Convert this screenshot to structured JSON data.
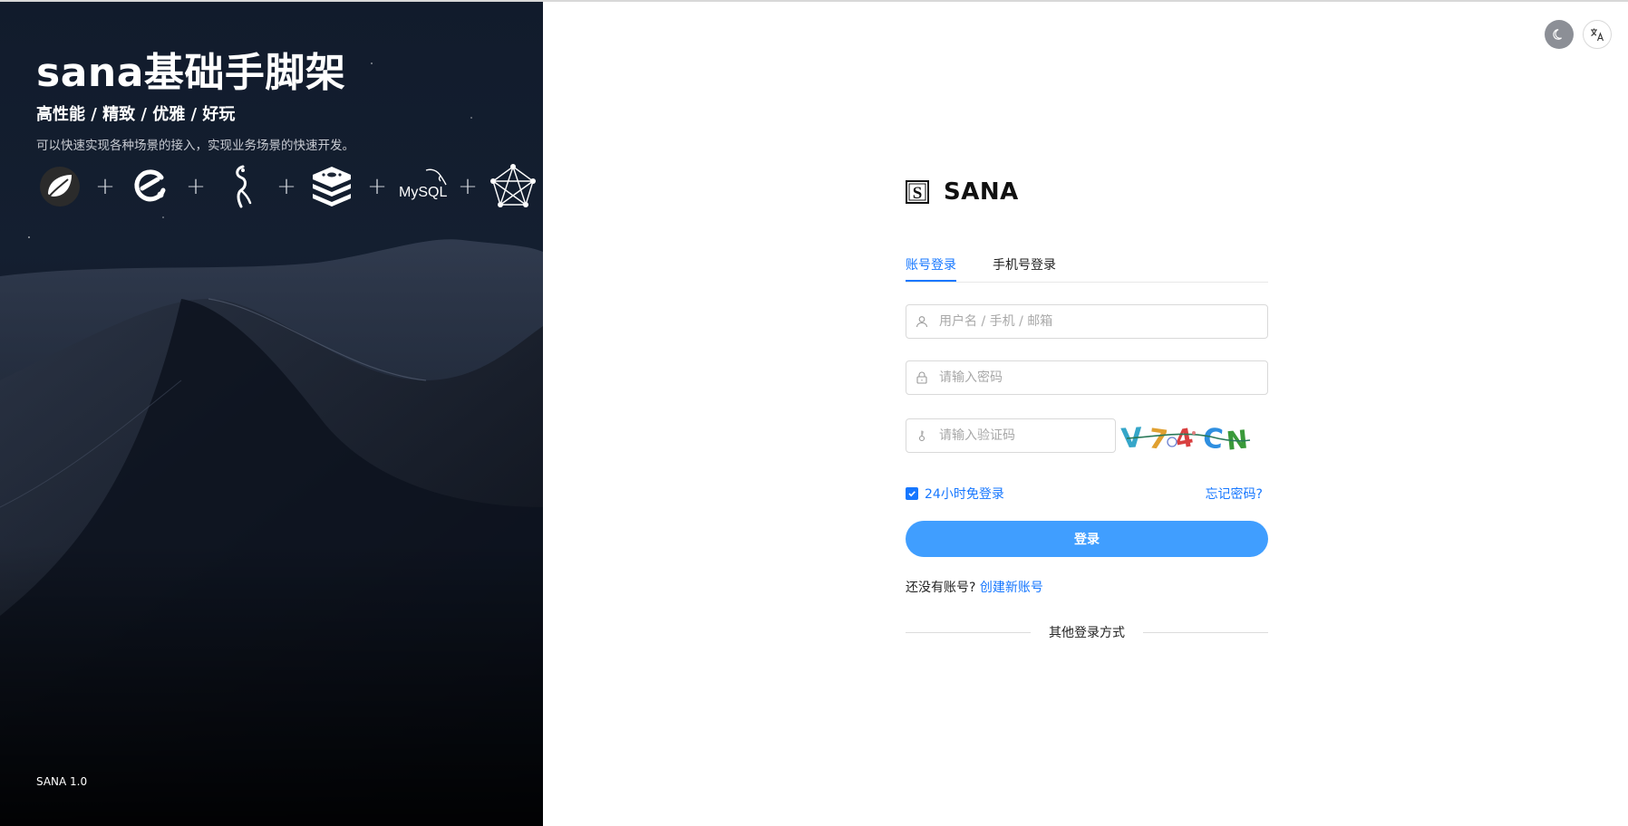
{
  "left_panel": {
    "title": "sana基础手脚架",
    "subtitle": "高性能 / 精致 / 优雅 / 好玩",
    "description": "可以快速实现各种场景的接入，实现业务场景的快速开发。",
    "tech_logos": [
      "spring-icon",
      "element-icon",
      "flowable-icon",
      "redis-icon",
      "mysql-icon",
      "graph-icon"
    ],
    "mysql_label": "MySQL",
    "plus": "+",
    "version": "SANA 1.0"
  },
  "toolbar": {
    "theme_icon": "moon-icon",
    "language_icon": "translate-icon"
  },
  "login": {
    "brand_letter": "S",
    "brand_name": "SANA",
    "tabs": [
      {
        "label": "账号登录",
        "active": true
      },
      {
        "label": "手机号登录",
        "active": false
      }
    ],
    "username_placeholder": "用户名 / 手机 / 邮箱",
    "password_placeholder": "请输入密码",
    "captcha_placeholder": "请输入验证码",
    "captcha_text": "V74CN",
    "remember_checked": true,
    "remember_label": "24小时免登录",
    "forgot_label": "忘记密码?",
    "submit_label": "登录",
    "register_prompt": "还没有账号?",
    "register_link": "创建新账号",
    "other_methods": "其他登录方式"
  },
  "colors": {
    "accent": "#1677ff",
    "button": "#409eff",
    "panel_dark": "#111b2c"
  }
}
